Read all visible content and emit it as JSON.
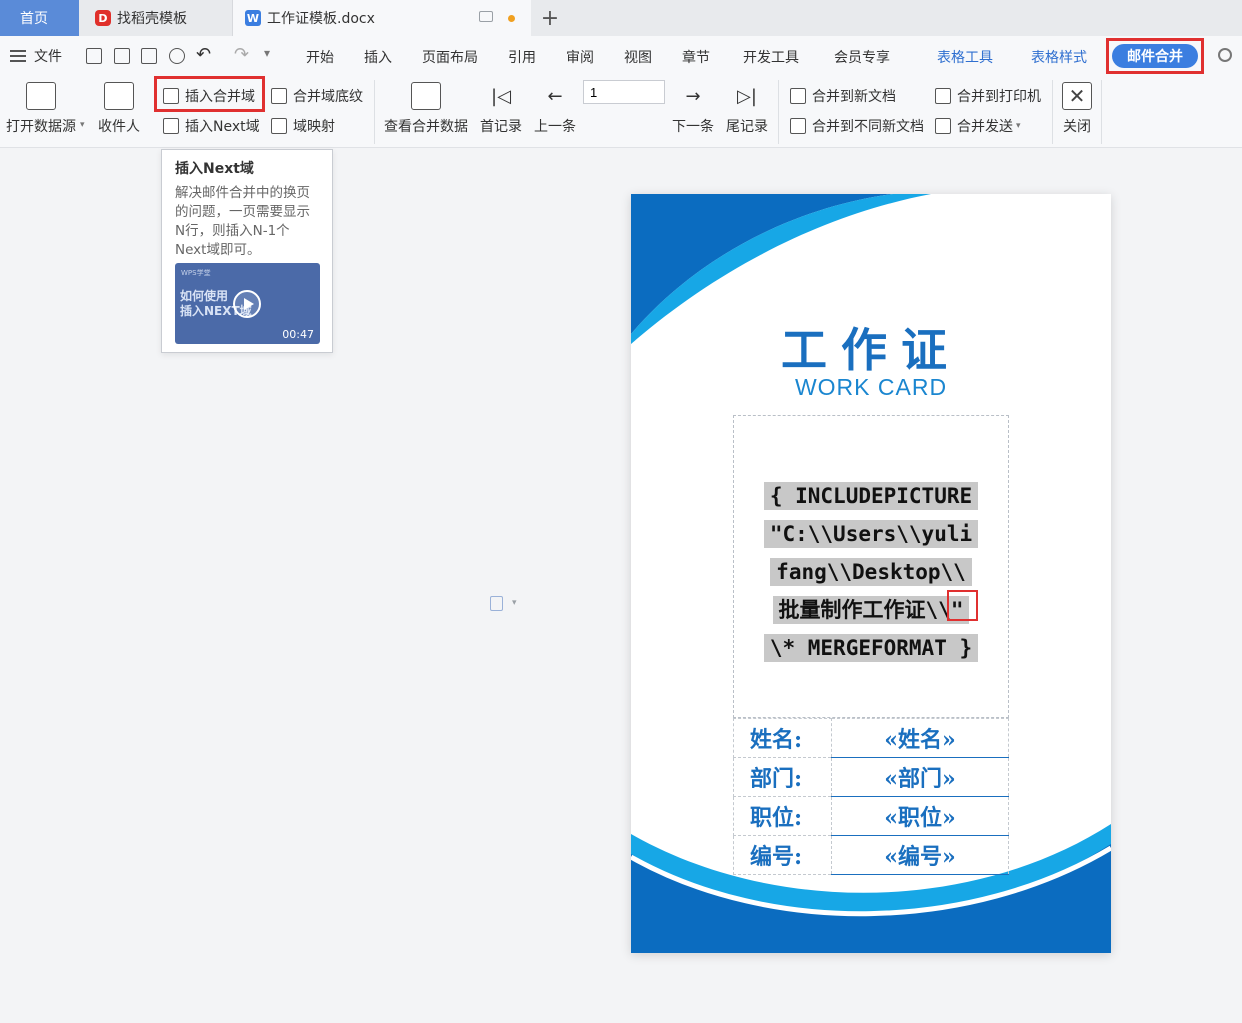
{
  "tabs": {
    "home": "首页",
    "daoke": "找稻壳模板",
    "daoke_icon": "D",
    "doc": "工作证模板.docx",
    "doc_icon": "W",
    "add": "+"
  },
  "menu": {
    "file": "文件",
    "items": [
      "开始",
      "插入",
      "页面布局",
      "引用",
      "审阅",
      "视图",
      "章节",
      "开发工具",
      "会员专享"
    ],
    "table_tools": "表格工具",
    "table_style": "表格样式",
    "mail_merge": "邮件合并"
  },
  "ribbon": {
    "open_datasource": "打开数据源",
    "recipients": "收件人",
    "insert_merge_field": "插入合并域",
    "insert_next_field": "插入Next域",
    "merge_field_shading": "合并域底纹",
    "field_mapping": "域映射",
    "view_merged_data": "查看合并数据",
    "first_record": "首记录",
    "prev_record": "上一条",
    "record_number": "1",
    "next_record": "下一条",
    "last_record": "尾记录",
    "merge_to_new_doc": "合并到新文档",
    "merge_to_diff_docs": "合并到不同新文档",
    "merge_to_printer": "合并到打印机",
    "merge_send": "合并发送",
    "close": "关闭"
  },
  "tooltip": {
    "title": "插入Next域",
    "desc": "解决邮件合并中的换页的问题，一页需要显示N行，则插入N-1个Next域即可。",
    "video_brand": "WPS学堂",
    "video_text_1": "如何使用",
    "video_text_2": "插入NEXT域",
    "duration": "00:47"
  },
  "document": {
    "title": "工作证",
    "subtitle": "WORK CARD",
    "field_code": [
      "{ INCLUDEPICTURE",
      "\"C:\\\\Users\\\\yuli",
      "fang\\\\Desktop\\\\",
      "批量制作工作证\\\\\"",
      "\\* MERGEFORMAT }"
    ],
    "rows": [
      {
        "label": "姓名:",
        "value": "«姓名»"
      },
      {
        "label": "部门:",
        "value": "«部门»"
      },
      {
        "label": "职位:",
        "value": "«职位»"
      },
      {
        "label": "编号:",
        "value": "«编号»"
      }
    ]
  },
  "colors": {
    "accent_blue": "#3b7ee0",
    "highlight_red": "#e03030",
    "card_blue": "#1a6fbf",
    "card_light_blue": "#17a7e6"
  }
}
